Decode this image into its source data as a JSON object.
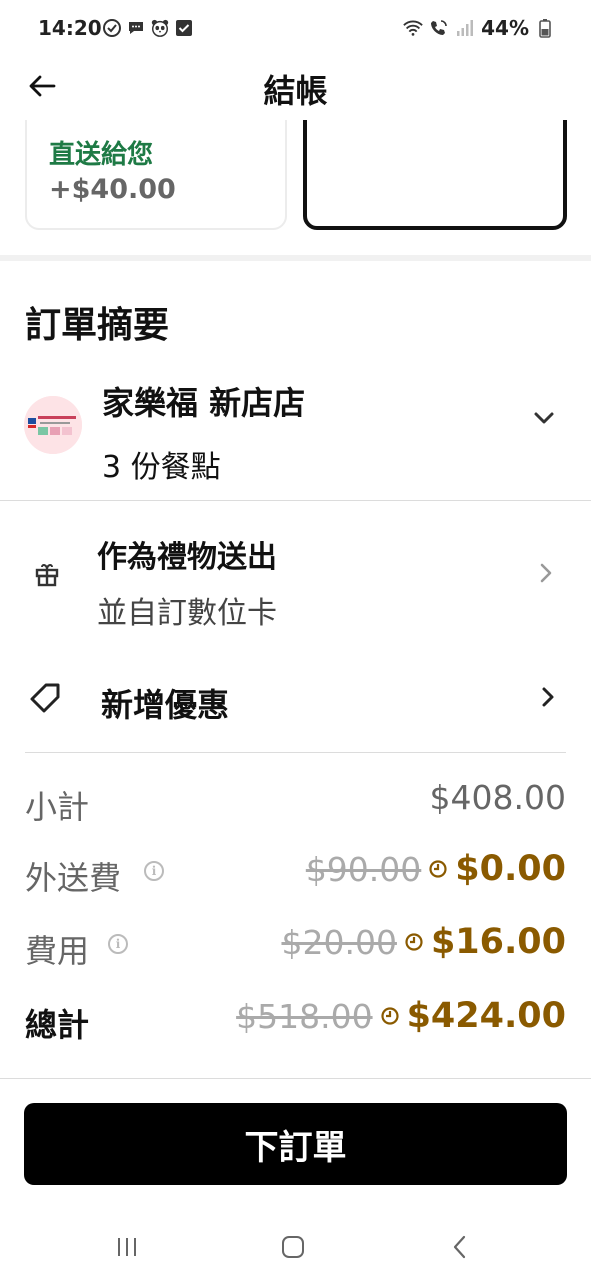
{
  "status_bar": {
    "time": "14:20",
    "battery": "44%"
  },
  "header": {
    "title": "結帳"
  },
  "delivery_option": {
    "title": "直送給您",
    "price": "+$40.00"
  },
  "summary": {
    "title": "訂單摘要",
    "store_name": "家樂福 新店店",
    "items_count": "3 份餐點"
  },
  "gift": {
    "title": "作為禮物送出",
    "subtitle": "並自訂數位卡"
  },
  "promo": {
    "label": "新增優惠"
  },
  "prices": {
    "subtotal_label": "小計",
    "subtotal_value": "$408.00",
    "delivery_label": "外送費",
    "delivery_old": "$90.00",
    "delivery_new": "$0.00",
    "fee_label": "費用",
    "fee_old": "$20.00",
    "fee_new": "$16.00",
    "total_label": "總計",
    "total_old": "$518.00",
    "total_new": "$424.00"
  },
  "actions": {
    "place_order": "下訂單"
  },
  "colors": {
    "accent_green": "#1e7a45",
    "discount_gold": "#8a5a00",
    "button_black": "#000000"
  }
}
